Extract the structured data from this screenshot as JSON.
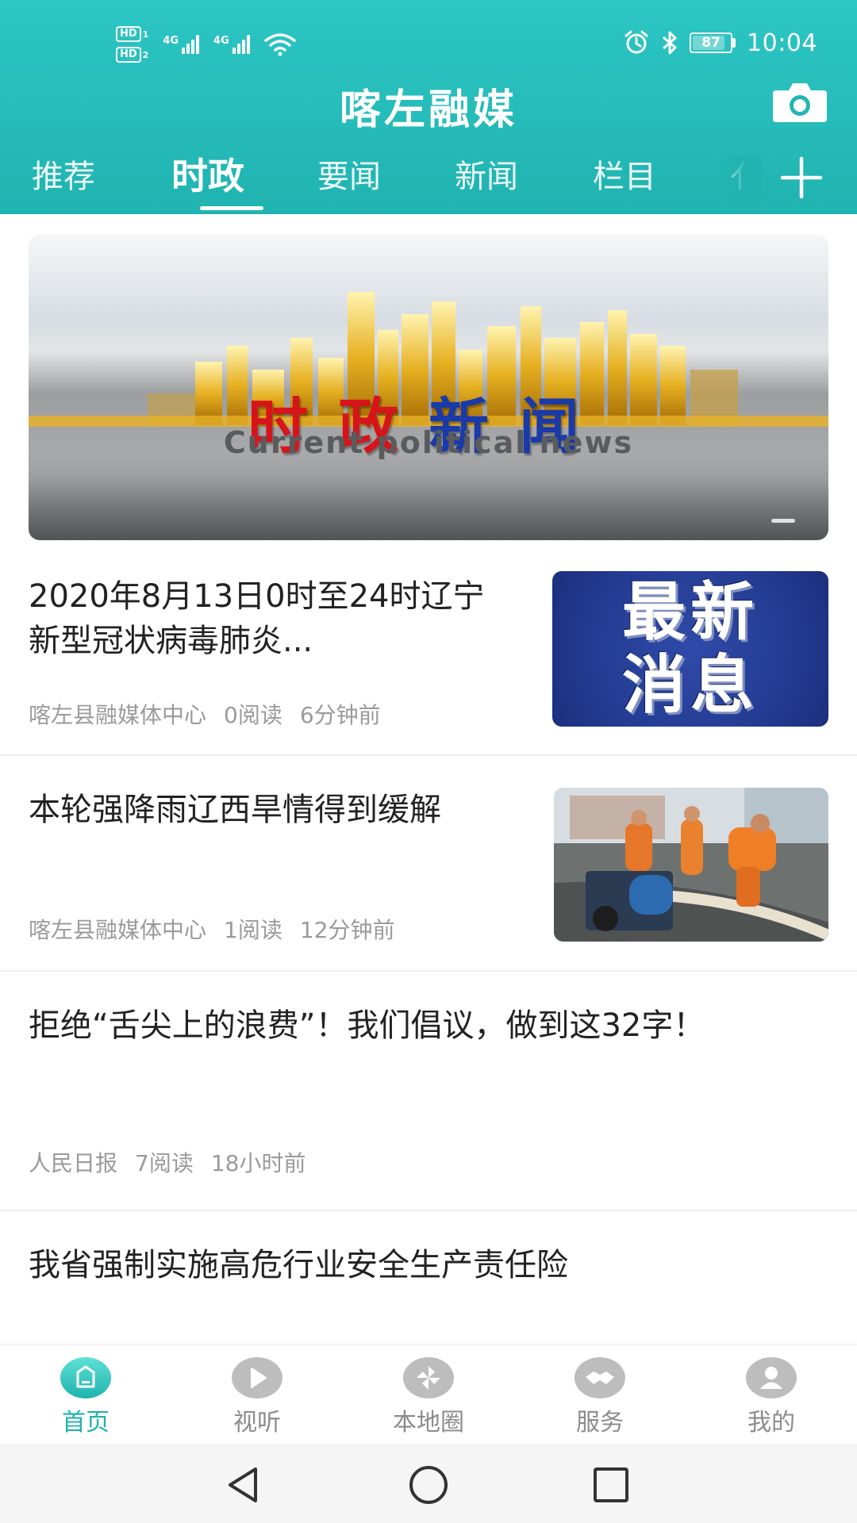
{
  "status_bar": {
    "sim1": "HD",
    "sim1_num": "1",
    "sim2": "HD",
    "sim2_num": "2",
    "network1": "4G",
    "network2": "4G",
    "battery": "87",
    "battery_level": 0.87,
    "time": "10:04"
  },
  "header": {
    "app_title": "喀左融媒",
    "tabs": [
      {
        "label": "推荐"
      },
      {
        "label": "时政"
      },
      {
        "label": "要闻"
      },
      {
        "label": "新闻"
      },
      {
        "label": "栏目"
      },
      {
        "label": "亻"
      }
    ],
    "active_tab": "时政"
  },
  "banner": {
    "title_chars": [
      "时",
      "政",
      "新",
      "闻"
    ],
    "subtitle": "Current political news"
  },
  "news": [
    {
      "title": "2020年8月13日0时至24时辽宁新型冠状病毒肺炎...",
      "source": "喀左县融媒体中心",
      "reads": "0阅读",
      "time": "6分钟前",
      "thumb_text_line1": "最新",
      "thumb_text_line2": "消息"
    },
    {
      "title": "本轮强降雨辽西旱情得到缓解",
      "source": "喀左县融媒体中心",
      "reads": "1阅读",
      "time": "12分钟前"
    },
    {
      "title": "拒绝“舌尖上的浪费”！我们倡议，做到这32字！",
      "source": "人民日报",
      "reads": "7阅读",
      "time": "18小时前"
    },
    {
      "title": "我省强制实施高危行业安全生产责任险"
    }
  ],
  "bottom_nav": [
    {
      "label": "首页",
      "icon": "home-icon",
      "active": true
    },
    {
      "label": "视听",
      "icon": "play-icon",
      "active": false
    },
    {
      "label": "本地圈",
      "icon": "pinwheel-icon",
      "active": false
    },
    {
      "label": "服务",
      "icon": "handshake-icon",
      "active": false
    },
    {
      "label": "我的",
      "icon": "user-icon",
      "active": false
    }
  ],
  "colors": {
    "header_start": "#2cc6c4",
    "header_end": "#20b3b0",
    "accent": "#1fb2ae",
    "nav_inactive": "#bdbdbd"
  }
}
